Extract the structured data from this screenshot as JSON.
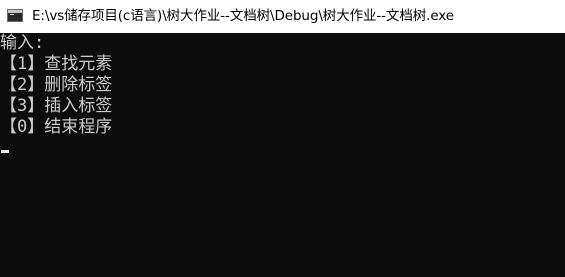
{
  "window": {
    "title": "E:\\vs储存项目(c语言)\\树大作业--文档树\\Debug\\树大作业--文档树.exe",
    "icon": "console-app-icon"
  },
  "console": {
    "prompt_label": "输入:",
    "menu_items": [
      {
        "text": "【1】查找元素"
      },
      {
        "text": "【2】删除标签"
      },
      {
        "text": "【3】插入标签"
      },
      {
        "text": "【0】结束程序"
      }
    ],
    "background_color": "#0c0c0c",
    "text_color": "#cccccc"
  }
}
